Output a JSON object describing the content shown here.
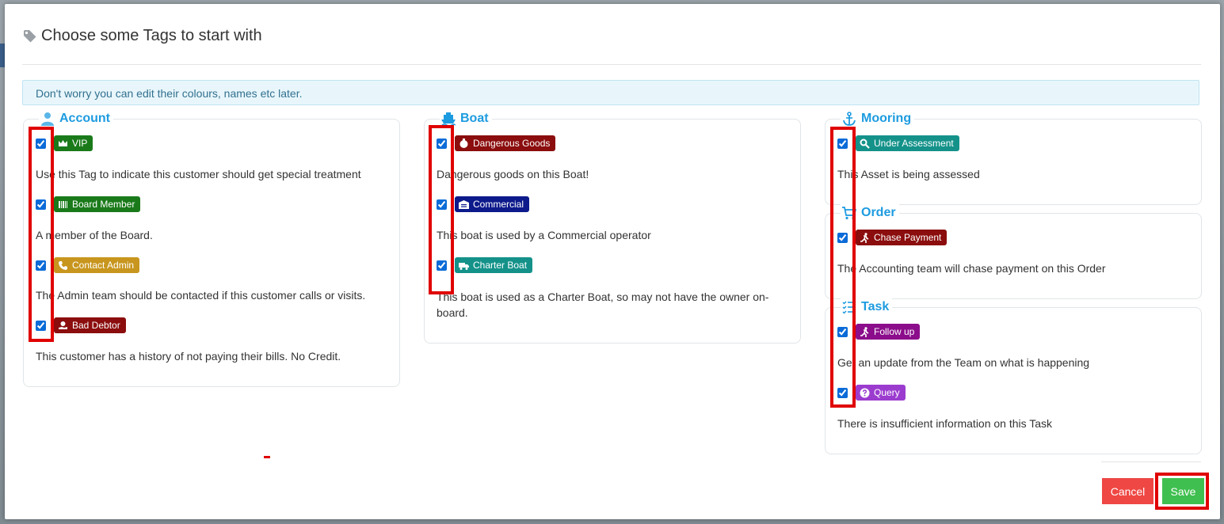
{
  "dialog": {
    "title": "Choose some Tags to start with",
    "info": "Don't worry you can edit their colours, names etc later."
  },
  "groups": {
    "account": {
      "title": "Account",
      "icon": "user-icon",
      "tags": [
        {
          "label": "VIP",
          "color": "#1a7a1a",
          "icon": "crown-icon",
          "checked": true,
          "description": "Use this Tag to indicate this customer should get special treatment"
        },
        {
          "label": "Board Member",
          "color": "#1a7a1a",
          "icon": "barcode-icon",
          "checked": true,
          "description": "A member of the Board."
        },
        {
          "label": "Contact Admin",
          "color": "#c8961e",
          "icon": "phone-icon",
          "checked": true,
          "description": "The Admin team should be contacted if this customer calls or visits."
        },
        {
          "label": "Bad Debtor",
          "color": "#8b0d0d",
          "icon": "hand-coin-icon",
          "checked": true,
          "description": "This customer has a history of not paying their bills. No Credit."
        }
      ]
    },
    "boat": {
      "title": "Boat",
      "icon": "ship-icon",
      "tags": [
        {
          "label": "Dangerous Goods",
          "color": "#8b0d0d",
          "icon": "flask-icon",
          "checked": true,
          "description": "Dangerous goods on this Boat!"
        },
        {
          "label": "Commercial",
          "color": "#0d1a8b",
          "icon": "warehouse-icon",
          "checked": true,
          "description": "This boat is used by a Commercial operator"
        },
        {
          "label": "Charter Boat",
          "color": "#14928a",
          "icon": "truck-icon",
          "checked": true,
          "description": "This boat is used as a Charter Boat, so may not have the owner on-board."
        }
      ]
    },
    "mooring": {
      "title": "Mooring",
      "icon": "anchor-icon",
      "tags": [
        {
          "label": "Under Assessment",
          "color": "#14928a",
          "icon": "search-icon",
          "checked": true,
          "description": "This Asset is being assessed"
        }
      ]
    },
    "order": {
      "title": "Order",
      "icon": "cart-icon",
      "tags": [
        {
          "label": "Chase Payment",
          "color": "#8b0d0d",
          "icon": "running-icon",
          "checked": true,
          "description": "The Accounting team will chase payment on this Order"
        }
      ]
    },
    "task": {
      "title": "Task",
      "icon": "checklist-icon",
      "tags": [
        {
          "label": "Follow up",
          "color": "#8b0d8b",
          "icon": "running-icon",
          "checked": true,
          "description": "Get an update from the Team on what is happening"
        },
        {
          "label": "Query",
          "color": "#9b3ccf",
          "icon": "question-circle-icon",
          "checked": true,
          "description": "There is insufficient information on this Task"
        }
      ]
    }
  },
  "footer": {
    "cancel_label": "Cancel",
    "save_label": "Save"
  },
  "colors": {
    "accent": "#1d9be0",
    "cancel": "#ef4744",
    "save": "#3fbf4f",
    "highlight": "#e00000"
  }
}
